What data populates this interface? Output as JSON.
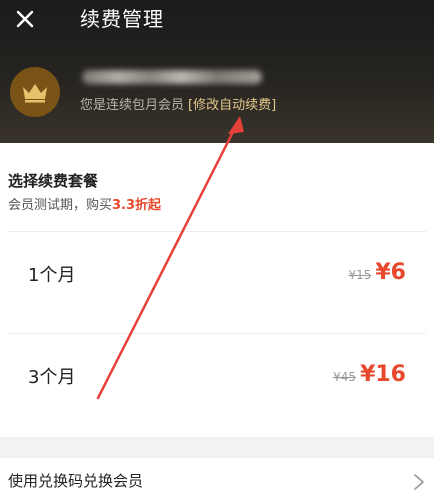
{
  "header": {
    "close_icon": "close-icon",
    "title": "续费管理",
    "member_status": "您是连续包月会员",
    "modify_label": "[修改自动续费]"
  },
  "plans_section": {
    "title": "选择续费套餐",
    "subtitle_prefix": "会员测试期，购买",
    "subtitle_highlight": "3.3折起",
    "plans": [
      {
        "name": "1个月",
        "old_price": "¥15",
        "new_price": "¥6"
      },
      {
        "name": "3个月",
        "old_price": "¥45",
        "new_price": "¥16"
      }
    ]
  },
  "redeem": {
    "label": "使用兑换码兑换会员",
    "icon": "chevron-right-icon"
  },
  "colors": {
    "header_bg": "#1b1b1b",
    "crown_bg": "#7a5417",
    "crown": "#e6c36a",
    "accent_gold": "#e2c78d",
    "price_red": "#e8492d",
    "annotation_arrow": "#e8413a"
  }
}
